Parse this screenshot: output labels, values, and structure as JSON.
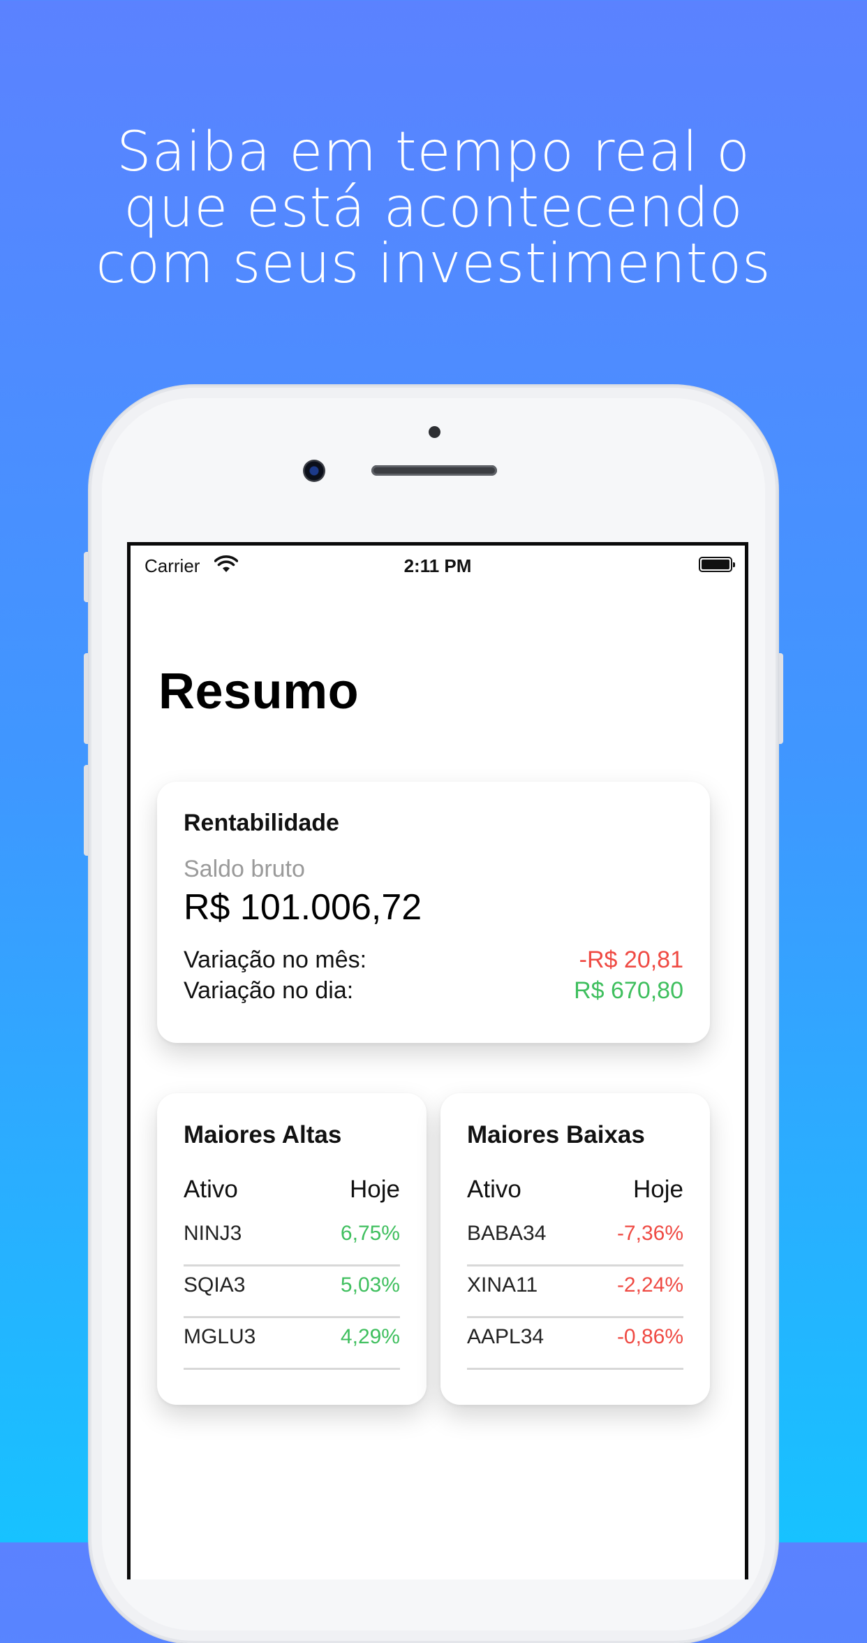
{
  "headline": {
    "line1": "Saiba  em tempo real o",
    "line2": "que está acontecendo",
    "line3": "com seus investimentos"
  },
  "status_bar": {
    "carrier": "Carrier",
    "time": "2:11 PM"
  },
  "page_title": "Resumo",
  "rentabilidade": {
    "title": "Rentabilidade",
    "saldo_label": "Saldo bruto",
    "saldo_value": "R$ 101.006,72",
    "variacao_mes_label": "Variação no mês:",
    "variacao_mes_value": "-R$ 20,81",
    "variacao_dia_label": "Variação no dia:",
    "variacao_dia_value": "R$ 670,80"
  },
  "maiores_altas": {
    "title": "Maiores Altas",
    "col_ativo": "Ativo",
    "col_hoje": "Hoje",
    "rows": [
      {
        "ativo": "NINJ3",
        "hoje": "6,75%"
      },
      {
        "ativo": "SQIA3",
        "hoje": "5,03%"
      },
      {
        "ativo": "MGLU3",
        "hoje": "4,29%"
      }
    ]
  },
  "maiores_baixas": {
    "title": "Maiores Baixas",
    "col_ativo": "Ativo",
    "col_hoje": "Hoje",
    "rows": [
      {
        "ativo": "BABA34",
        "hoje": "-7,36%"
      },
      {
        "ativo": "XINA11",
        "hoje": "-2,24%"
      },
      {
        "ativo": "AAPL34",
        "hoje": "-0,86%"
      }
    ]
  },
  "colors": {
    "background_top": "#5b82ff",
    "background_bottom": "#17c2ff",
    "positive": "#3fbf5e",
    "negative": "#ef4a43"
  }
}
